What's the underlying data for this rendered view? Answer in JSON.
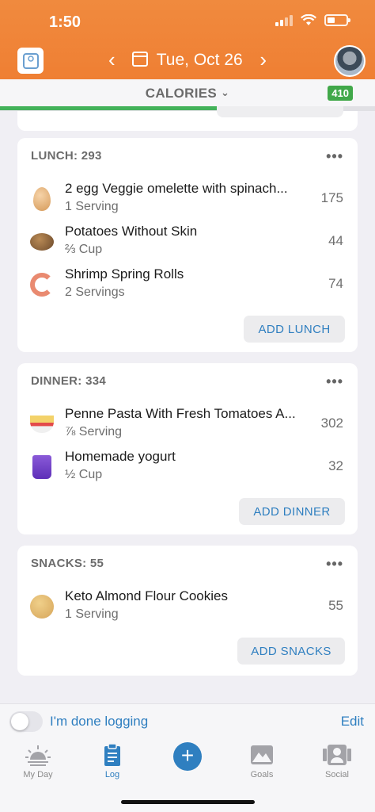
{
  "status": {
    "time": "1:50"
  },
  "header": {
    "date": "Tue, Oct 26"
  },
  "calories": {
    "label": "CALORIES",
    "remaining_badge": "410",
    "progress_fraction": 0.59
  },
  "meals": {
    "lunch": {
      "title": "LUNCH: 293",
      "items": [
        {
          "name": "2 egg Veggie omelette with spinach...",
          "qty": "1 Serving",
          "cal": "175",
          "icon": "egg-icon"
        },
        {
          "name": "Potatoes Without Skin",
          "qty": "⅔ Cup",
          "cal": "44",
          "icon": "potato-icon"
        },
        {
          "name": "Shrimp Spring Rolls",
          "qty": "2 Servings",
          "cal": "74",
          "icon": "shrimp-icon"
        }
      ],
      "add_label": "ADD LUNCH"
    },
    "dinner": {
      "title": "DINNER: 334",
      "items": [
        {
          "name": "Penne Pasta With Fresh Tomatoes A...",
          "qty": "⅞ Serving",
          "cal": "302",
          "icon": "pasta-bowl-icon"
        },
        {
          "name": "Homemade yogurt",
          "qty": "½ Cup",
          "cal": "32",
          "icon": "yogurt-cup-icon"
        }
      ],
      "add_label": "ADD DINNER"
    },
    "snacks": {
      "title": "SNACKS: 55",
      "items": [
        {
          "name": "Keto Almond Flour Cookies",
          "qty": "1 Serving",
          "cal": "55",
          "icon": "cookie-icon"
        }
      ],
      "add_label": "ADD SNACKS"
    }
  },
  "footer": {
    "done_label": "I'm done logging",
    "edit_label": "Edit"
  },
  "tabs": [
    {
      "label": "My Day",
      "icon": "sunrise-icon"
    },
    {
      "label": "Log",
      "icon": "clipboard-icon"
    },
    {
      "label": "",
      "icon": "plus-icon"
    },
    {
      "label": "Goals",
      "icon": "mountain-icon"
    },
    {
      "label": "Social",
      "icon": "people-icon"
    }
  ],
  "colors": {
    "header": "#ef8236",
    "accent_blue": "#2f7fc0",
    "green": "#41a84a"
  }
}
